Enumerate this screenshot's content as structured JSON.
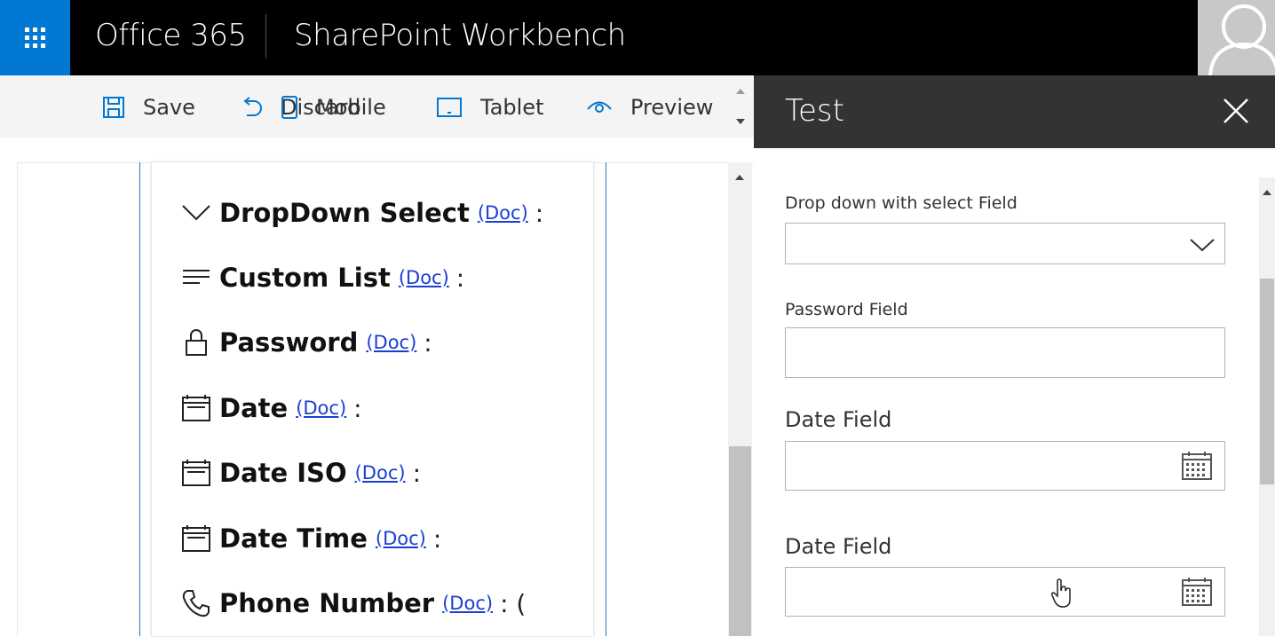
{
  "header": {
    "brand": "Office 365",
    "app_title": "SharePoint Workbench"
  },
  "toolbar": {
    "save": "Save",
    "discard": "Discard",
    "mobile": "Mobile",
    "tablet": "Tablet",
    "preview": "Preview"
  },
  "webpart": {
    "rows": [
      {
        "icon": "chevron-down-icon",
        "label": "DropDown Select",
        "doc": "(Doc)",
        "suffix": ":"
      },
      {
        "icon": "list-icon",
        "label": "Custom List",
        "doc": "(Doc)",
        "suffix": ":"
      },
      {
        "icon": "lock-icon",
        "label": "Password",
        "doc": "(Doc)",
        "suffix": ":"
      },
      {
        "icon": "calendar-icon",
        "label": "Date",
        "doc": "(Doc)",
        "suffix": ":"
      },
      {
        "icon": "calendar-icon",
        "label": "Date ISO",
        "doc": "(Doc)",
        "suffix": ":"
      },
      {
        "icon": "calendar-icon",
        "label": "Date Time",
        "doc": "(Doc)",
        "suffix": ":"
      },
      {
        "icon": "phone-icon",
        "label": "Phone Number",
        "doc": "(Doc)",
        "suffix": ": ("
      }
    ]
  },
  "panel": {
    "title": "Test",
    "fields": [
      {
        "label": "Drop down with select Field",
        "type": "dropdown",
        "value": ""
      },
      {
        "label": "Password Field",
        "type": "password",
        "value": ""
      },
      {
        "label": "Date Field",
        "type": "date",
        "value": ""
      },
      {
        "label": "Date Field",
        "type": "date",
        "value": ""
      }
    ]
  },
  "colors": {
    "accent": "#0078d4",
    "link": "#1a3fd3",
    "topbar": "#000000",
    "panel_header": "#333333"
  }
}
